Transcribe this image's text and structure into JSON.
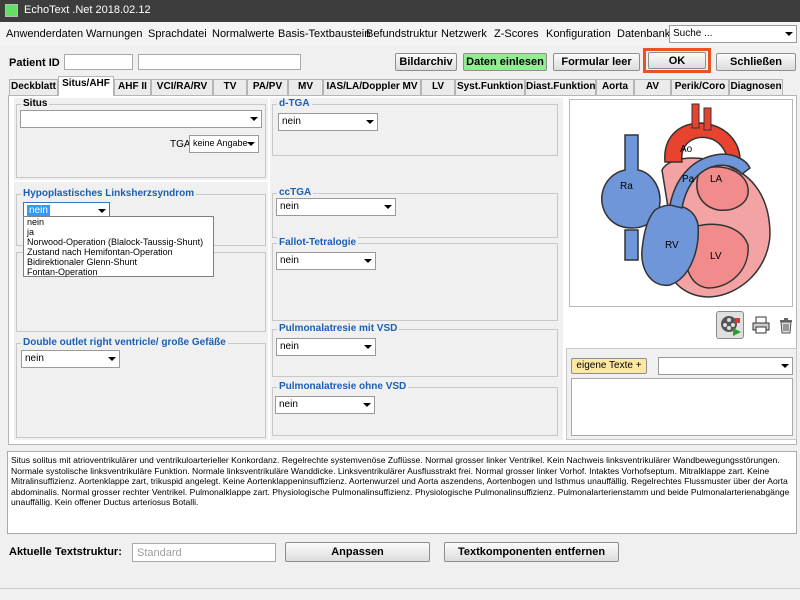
{
  "window": {
    "title": "EchoText .Net 2018.02.12"
  },
  "menu": {
    "items": [
      "Anwenderdaten",
      "Warnungen",
      "Sprachdatei",
      "Normalwerte",
      "Basis-Textbaustein",
      "Befundstruktur",
      "Netzwerk",
      "Z-Scores",
      "Konfiguration",
      "Datenbank"
    ],
    "search_value": "Suche ..."
  },
  "patient": {
    "label": "Patient ID"
  },
  "toolbar": {
    "bildarchiv": "Bildarchiv",
    "daten_einlesen": "Daten einlesen",
    "formular_leer": "Formular leer",
    "ok": "OK",
    "schliessen": "Schließen"
  },
  "tabs": [
    "Deckblatt",
    "Situs/AHF",
    "AHF II",
    "VCI/RA/RV",
    "TV",
    "PA/PV",
    "MV",
    "IAS/LA/Doppler MV",
    "LV",
    "Syst.Funktion",
    "Diast.Funktion",
    "Aorta",
    "AV",
    "Perik/Coro",
    "Diagnosen"
  ],
  "active_tab": "Situs/AHF",
  "groups": {
    "situs": {
      "title": "Situs",
      "value": "",
      "tga_label": "TGA",
      "tga_value": "keine Angabe"
    },
    "hypoplast": {
      "title": "Hypoplastisches Linksherzsyndrom",
      "value": "nein",
      "options": [
        "nein",
        "ja",
        "Norwood-Operation (Blalock-Taussig-Shunt)",
        "Zustand nach Hemifontan-Operation",
        "Bidirektionaler Glenn-Shunt",
        "Fontan-Operation"
      ]
    },
    "dorv": {
      "title": "Double outlet right ventricle/ große Gefäße",
      "value": "nein"
    },
    "dtga": {
      "title": "d-TGA",
      "value": "nein"
    },
    "cctga": {
      "title": "ccTGA",
      "value": "nein"
    },
    "fallot": {
      "title": "Fallot-Tetralogie",
      "value": "nein"
    },
    "pa_vsd": {
      "title": "Pulmonalatresie mit VSD",
      "value": "nein"
    },
    "pa_ohne": {
      "title": "Pulmonalatresie ohne VSD",
      "value": "nein"
    }
  },
  "heart": {
    "labels": [
      "Ao",
      "Pa",
      "LA",
      "Ra",
      "RV",
      "LV"
    ]
  },
  "eigene": {
    "button": "eigene Texte +",
    "value": ""
  },
  "report_text": "Situs solitus mit atrioventrikulärer und ventrikuloarterieller Konkordanz. Regelrechte systemvenöse Zuflüsse. Normal grosser linker Ventrikel. Kein Nachweis linksventrikulärer Wandbewegungsstörungen. Normale systolische linksventrikuläre Funktion. Normale linksventrikuläre Wanddicke. Linksventrikulärer Ausflusstrakt frei. Normal grosser linker Vorhof. Intaktes Vorhofseptum. Mitralklappe zart. Keine Mitralinsuffizienz. Aortenklappe zart, trikuspid angelegt. Keine Aortenklappeninsuffizienz. Aortenwurzel und Aorta aszendens, Aortenbogen und Isthmus unauffällig. Regelrechtes Flussmuster über der Aorta abdominalis. Normal grosser rechter Ventrikel. Pulmonalklappe zart. Physiologische Pulmonalinsuffizienz. Physiologische Pulmonalinsuffizienz. Pulmonalarterienstamm und beide Pulmonalarterienabgänge unauffällig. Kein offener Ductus arteriosus Botalli.",
  "bottom": {
    "label": "Aktuelle Textstruktur:",
    "value": "Standard",
    "anpassen": "Anpassen",
    "entfernen": "Textkomponenten entfernen"
  },
  "colors": {
    "ok_highlight": "#e8531f",
    "daten_green": "#90ee90",
    "group_title": "#1a5fb4"
  }
}
